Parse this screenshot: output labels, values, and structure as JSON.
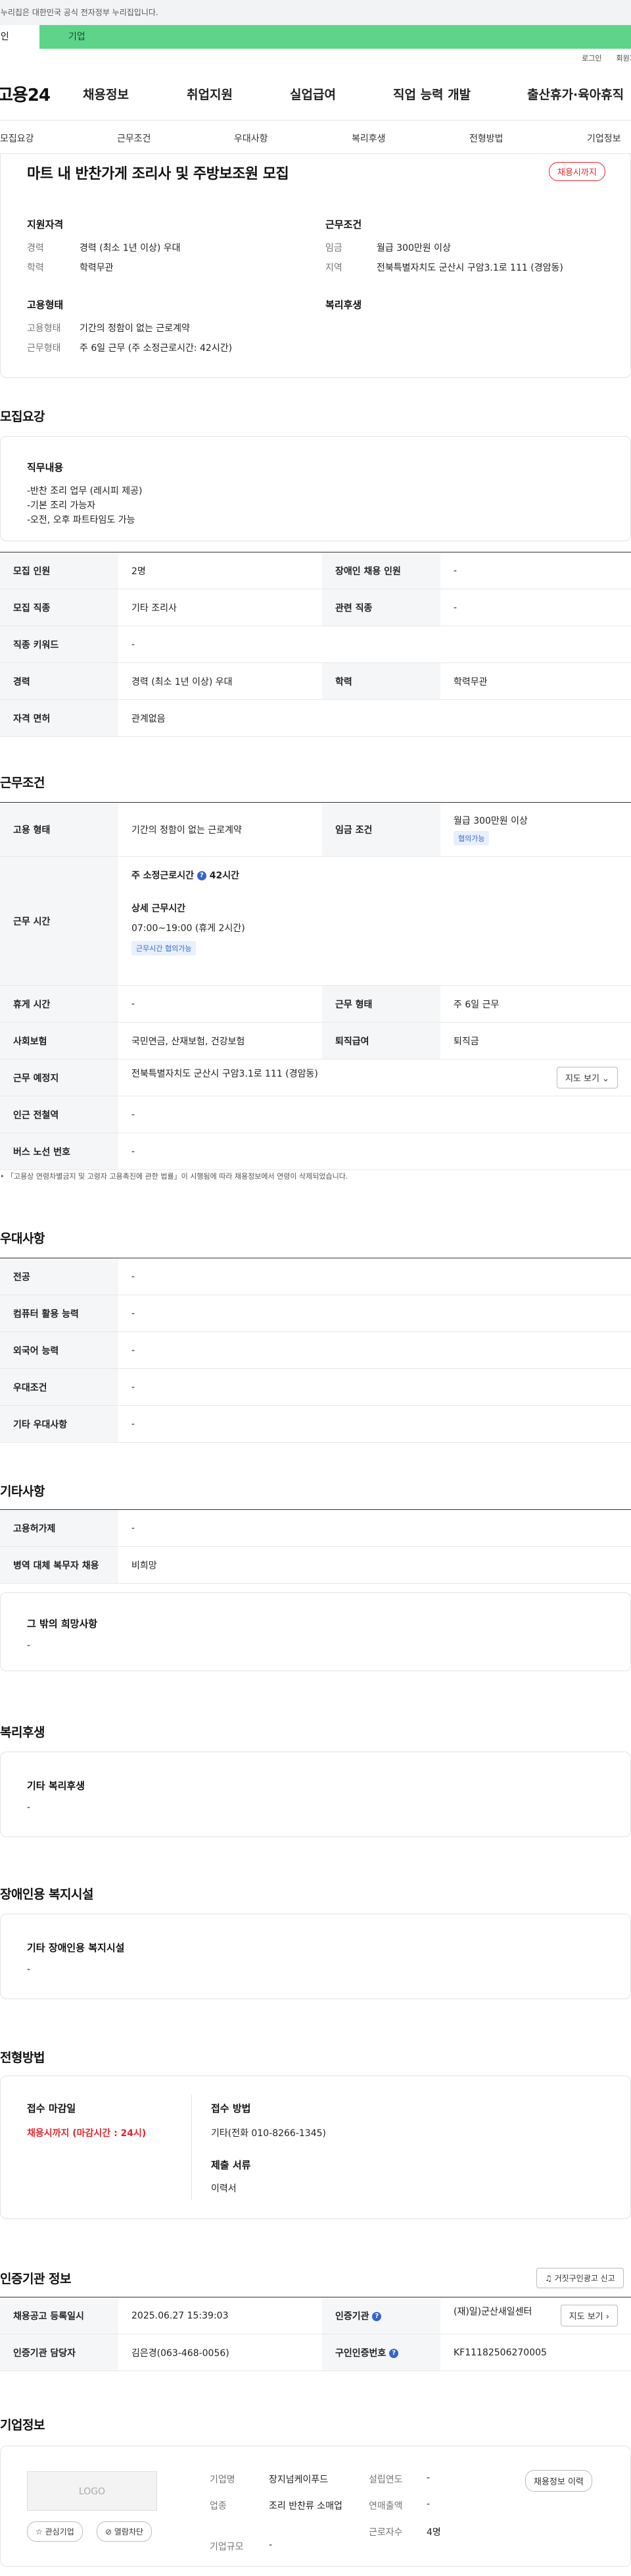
{
  "banner": {
    "text": "이 누리집은 대한민국 공식 전자정부 누리집입니다."
  },
  "user_tabs": {
    "personal": "개인",
    "company": "기업"
  },
  "util": {
    "login": "로그인",
    "signup": "회원가입"
  },
  "gnb": {
    "logo": "고용24",
    "menu": [
      "채용정보",
      "취업지원",
      "실업급여",
      "직업 능력 개발",
      "출산휴가·육아휴직"
    ]
  },
  "subnav": [
    "모집요강",
    "근무조건",
    "우대사항",
    "복리후생",
    "전형방법",
    "기업정보"
  ],
  "summary": {
    "title": "마트 내 반찬가게 조리사 및 주방보조원 모집",
    "badge": "채용시까지",
    "qualification_head": "지원자격",
    "career_label": "경력",
    "career_value": "경력 (최소 1년 이상) 우대",
    "edu_label": "학력",
    "edu_value": "학력무관",
    "work_head": "근무조건",
    "wage_label": "임금",
    "wage_value": "월급 300만원 이상",
    "region_label": "지역",
    "region_value": "전북특별자치도 군산시 구암3.1로 111 (경암동)",
    "emp_head": "고용형태",
    "emp_type_label": "고용형태",
    "emp_type_value": "기간의 정함이 없는 근로계약",
    "work_form_label": "근무형태",
    "work_form_value": "주 6일 근무 (주 소정근로시간: 42시간)",
    "welfare_head": "복리후생"
  },
  "recruit": {
    "section": "모집요강",
    "duty_head": "직무내용",
    "duty_lines": [
      "-반찬 조리 업무 (레시피 제공)",
      "-기본 조리 가능자",
      "-오전, 오후 파트타임도 가능"
    ],
    "rows": {
      "count_h": "모집 인원",
      "count_v": "2명",
      "disabled_h": "장애인 채용 인원",
      "disabled_v": "-",
      "job_h": "모집 직종",
      "job_v": "기타 조리사",
      "related_h": "관련 직종",
      "related_v": "-",
      "keyword_h": "직종 키워드",
      "keyword_v": "-",
      "career_h": "경력",
      "career_v": "경력 (최소 1년 이상) 우대",
      "edu_h": "학력",
      "edu_v": "학력무관",
      "license_h": "자격 면허",
      "license_v": "관계없음"
    }
  },
  "conditions": {
    "section": "근무조건",
    "emp_h": "고용 형태",
    "emp_v": "기간의 정함이 없는 근로계약",
    "wage_h": "임금 조건",
    "wage_v": "월급 300만원 이상",
    "wage_chip": "협의가능",
    "hours_h": "근무 시간",
    "hours_weekly": "주 소정근로시간",
    "hours_weekly_v": "42시간",
    "hours_detail_head": "상세 근무시간",
    "hours_detail_v": "07:00~19:00 (휴게 2시간)",
    "hours_chip": "근무시간 협의가능",
    "rest_h": "휴게 시간",
    "rest_v": "-",
    "form_h": "근무 형태",
    "form_v": "주 6일 근무",
    "insurance_h": "사회보험",
    "insurance_v": "국민연금, 산재보험, 건강보험",
    "retire_h": "퇴직급여",
    "retire_v": "퇴직금",
    "place_h": "근무 예정지",
    "place_v": "전북특별자치도 군산시 구암3.1로 111 (경암동)",
    "map_btn": "지도 보기",
    "subway_h": "인근 전철역",
    "subway_v": "-",
    "bus_h": "버스 노선 번호",
    "bus_v": "-",
    "note": "「고용상 연령차별금지 및 고령자 고용촉진에 관한 법률」이 시행됨에 따라 채용정보에서 연령이 삭제되었습니다."
  },
  "preferred": {
    "section": "우대사항",
    "major_h": "전공",
    "major_v": "-",
    "computer_h": "컴퓨터 활용 능력",
    "computer_v": "-",
    "lang_h": "외국어 능력",
    "lang_v": "-",
    "cond_h": "우대조건",
    "cond_v": "-",
    "etc_h": "기타 우대사항",
    "etc_v": "-"
  },
  "others": {
    "section": "기타사항",
    "insurance_h": "고용허가제",
    "insurance_v": "-",
    "military_h": "병역 대체 복무자 채용",
    "military_v": "비희망",
    "wish_head": "그 밖의 희망사항",
    "wish_v": "-"
  },
  "welfare": {
    "section": "복리후생",
    "head": "기타 복리후생",
    "value": "-"
  },
  "disabled": {
    "section": "장애인용 복지시설",
    "head": "기타 장애인용 복지시설",
    "value": "-"
  },
  "selection": {
    "section": "전형방법",
    "deadline_head": "접수 마감일",
    "deadline_v": "채용시까지 (마감시간 : 24시)",
    "method_head": "접수 방법",
    "method_v": "기타(전화 010-8266-1345)",
    "docs_head": "제출 서류",
    "docs_v": "이력서"
  },
  "auth": {
    "section": "인증기관 정보",
    "report_btn": "거짓구인광고 신고",
    "reg_h": "채용공고 등록일시",
    "reg_v": "2025.06.27 15:39:03",
    "org_h": "인증기관",
    "org_v": "(재)일)군산새일센터",
    "org_btn": "지도 보기",
    "manager_h": "인증기관 담당자",
    "manager_v": "김은경(063-468-0056)",
    "cert_h": "구인인증번호",
    "cert_v": "KF11182506270005"
  },
  "company": {
    "section": "기업정보",
    "logo": "LOGO",
    "fav_btn": "관심기업",
    "block_btn": "열람차단",
    "name_label": "기업명",
    "name_value": "장지넘케이푸드",
    "industry_label": "업종",
    "industry_value": "조리 반찬류 소매업",
    "size_label": "기업규모",
    "size_value": "-",
    "founded_label": "설립연도",
    "founded_value": "-",
    "sales_label": "연매출액",
    "sales_value": "-",
    "employees_label": "근로자수",
    "employees_value": "4명",
    "history_btn": "채용정보 이력"
  }
}
